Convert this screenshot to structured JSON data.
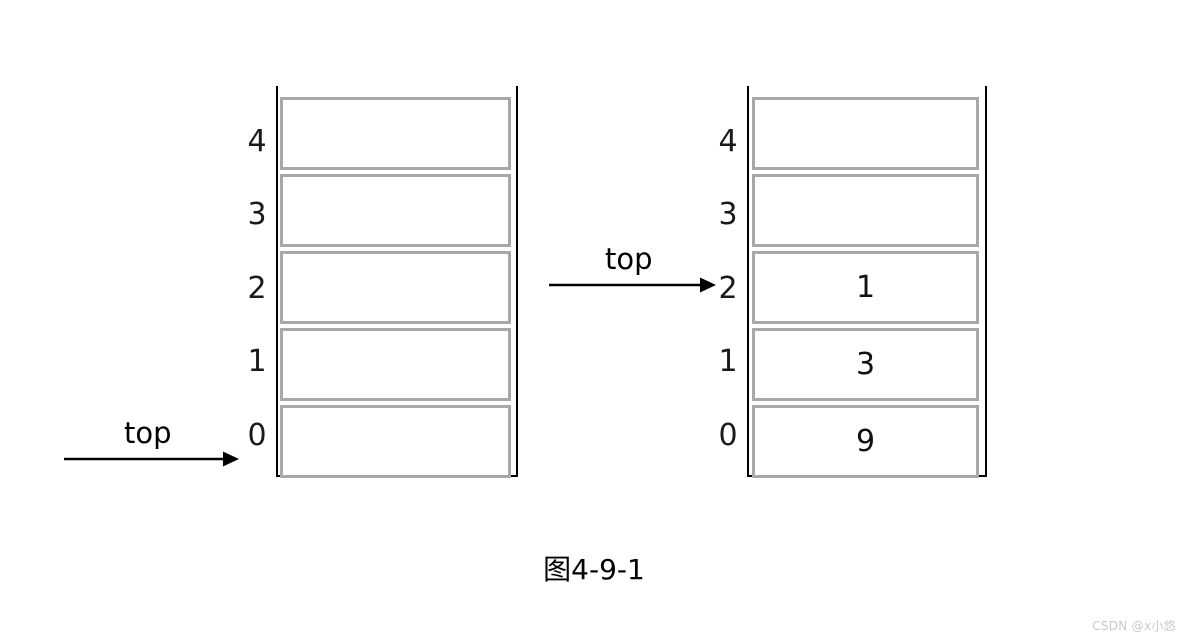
{
  "figure": {
    "caption": "图4-9-1",
    "watermark": "CSDN @x小悠",
    "background_color": "#ffffff",
    "cell_border_color": "#a8a8a8",
    "rail_color": "#000000",
    "text_color": "#000000"
  },
  "stacks": [
    {
      "id": "left-stack",
      "name": "empty-stack",
      "indices": [
        "4",
        "3",
        "2",
        "1",
        "0"
      ],
      "cells": [
        {
          "index": "4",
          "value": ""
        },
        {
          "index": "3",
          "value": ""
        },
        {
          "index": "2",
          "value": ""
        },
        {
          "index": "1",
          "value": ""
        },
        {
          "index": "0",
          "value": ""
        }
      ],
      "pointer": {
        "label": "top",
        "points_to_index": "0"
      }
    },
    {
      "id": "right-stack",
      "name": "filled-stack",
      "indices": [
        "4",
        "3",
        "2",
        "1",
        "0"
      ],
      "cells": [
        {
          "index": "4",
          "value": ""
        },
        {
          "index": "3",
          "value": ""
        },
        {
          "index": "2",
          "value": "1"
        },
        {
          "index": "1",
          "value": "3"
        },
        {
          "index": "0",
          "value": "9"
        }
      ],
      "pointer": {
        "label": "top",
        "points_to_index": "2"
      }
    }
  ]
}
